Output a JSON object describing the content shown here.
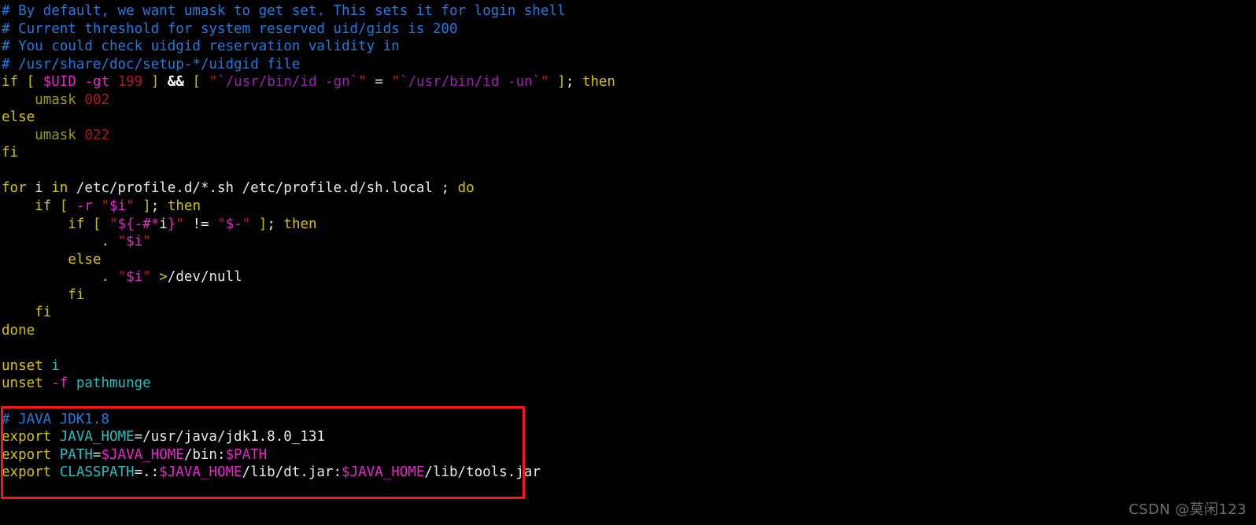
{
  "terminal": {
    "background_color": "#000000",
    "title": "/etc/profile shell configuration"
  },
  "colors": {
    "comment": "#1f7ae0",
    "keyword": "#d4c20a",
    "builtin": "#a0960a",
    "variable": "#e526c9",
    "identifier": "#25bdbd",
    "number": "#a81818",
    "string_quote": "#c01818",
    "command_substitution": "#9b1fb0",
    "plain_text": "#dadada",
    "annotation_red": "#fa1616",
    "watermark_gray": "#6e6e6e"
  },
  "code_lines": [
    {
      "id": "line-1",
      "text": "# By default, we want umask to get set. This sets it for login shell"
    },
    {
      "id": "line-2",
      "text": "# Current threshold for system reserved uid/gids is 200"
    },
    {
      "id": "line-3",
      "text": "# You could check uidgid reservation validity in"
    },
    {
      "id": "line-4",
      "text": "# /usr/share/doc/setup-*/uidgid file"
    },
    {
      "id": "line-5",
      "text": "if [ $UID -gt 199 ] && [ \"`/usr/bin/id -gn`\" = \"`/usr/bin/id -un`\" ]; then"
    },
    {
      "id": "line-6",
      "text": "   umask 002"
    },
    {
      "id": "line-7",
      "text": "else"
    },
    {
      "id": "line-8",
      "text": "   umask 022"
    },
    {
      "id": "line-9",
      "text": "fi"
    },
    {
      "id": "line-10",
      "text": ""
    },
    {
      "id": "line-11",
      "text": "for i in /etc/profile.d/*.sh /etc/profile.d/sh.local ; do"
    },
    {
      "id": "line-12",
      "text": "   if [ -r \"$i\" ]; then"
    },
    {
      "id": "line-13",
      "text": "       if [ \"${-#*i}\" != \"$-\" ]; then"
    },
    {
      "id": "line-14",
      "text": "           . \"$i\""
    },
    {
      "id": "line-15",
      "text": "       else"
    },
    {
      "id": "line-16",
      "text": "           . \"$i\" >/dev/null"
    },
    {
      "id": "line-17",
      "text": "       fi"
    },
    {
      "id": "line-18",
      "text": "   fi"
    },
    {
      "id": "line-19",
      "text": "done"
    },
    {
      "id": "line-20",
      "text": ""
    },
    {
      "id": "line-21",
      "text": "unset i"
    },
    {
      "id": "line-22",
      "text": "unset -f pathmunge"
    },
    {
      "id": "line-23",
      "text": ""
    },
    {
      "id": "line-24",
      "text": "# JAVA JDK1.8"
    },
    {
      "id": "line-25",
      "text": "export JAVA_HOME=/usr/java/jdk1.8.0_131"
    },
    {
      "id": "line-26",
      "text": "export PATH=$JAVA_HOME/bin:$PATH"
    },
    {
      "id": "line-27",
      "text": "export CLASSPATH=.:$JAVA_HOME/lib/dt.jar:$JAVA_HOME/lib/tools.jar"
    }
  ],
  "tokens": {
    "l1": {
      "comment": "# By default, we want umask to get set. This sets it for login shell"
    },
    "l2": {
      "comment": "# Current threshold for system reserved uid/gids is 200"
    },
    "l3": {
      "comment": "# You could check uidgid reservation validity in"
    },
    "l4": {
      "comment": "# /usr/share/doc/setup-*/uidgid file"
    },
    "l5": {
      "kw_if": "if",
      "br_open": "[",
      "var_uid": "$UID",
      "flag_gt": "-gt",
      "num_199": "199",
      "br_close": "]",
      "op_and": "&&",
      "br_open2": "[",
      "q1": "\"",
      "sub1": "`/usr/bin/id -gn`",
      "q2": "\"",
      "eq": "=",
      "q3": "\"",
      "sub2": "`/usr/bin/id -un`",
      "q4": "\"",
      "br_close2": "]",
      "semi": ";",
      "kw_then": "then"
    },
    "l6": {
      "builtin": "umask",
      "num": "002"
    },
    "l7": {
      "kw": "else"
    },
    "l8": {
      "builtin": "umask",
      "num": "022"
    },
    "l9": {
      "kw": "fi"
    },
    "l11": {
      "kw_for": "for",
      "var": "i",
      "kw_in": "in",
      "path1": "/etc/profile.d/*.sh",
      "path2": "/etc/profile.d/sh.local",
      "semi": ";",
      "kw_do": "do"
    },
    "l12": {
      "kw_if": "if",
      "br_open": "[",
      "flag_r": "-r",
      "q1": "\"",
      "var_i": "$i",
      "q2": "\"",
      "br_close": "]",
      "semi": ";",
      "kw_then": "then"
    },
    "l13": {
      "kw_if": "if",
      "br_open": "[",
      "q1": "\"",
      "param": "${-#*",
      "param_i": "i",
      "param_end": "}",
      "q2": "\"",
      "op_ne": "!=",
      "q3": "\"",
      "dollar_dash": "$-",
      "q4": "\"",
      "br_close": "]",
      "semi": ";",
      "kw_then": "then"
    },
    "l14": {
      "dot": ".",
      "q1": "\"",
      "var_i": "$i",
      "q2": "\""
    },
    "l15": {
      "kw": "else"
    },
    "l16": {
      "dot": ".",
      "q1": "\"",
      "var_i": "$i",
      "q2": "\"",
      "redir": ">",
      "path": "/dev/null"
    },
    "l17": {
      "kw": "fi"
    },
    "l18": {
      "kw": "fi"
    },
    "l19": {
      "kw": "done"
    },
    "l21": {
      "kw_unset": "unset",
      "ident": "i"
    },
    "l22": {
      "kw_unset": "unset",
      "flag_f": "-f",
      "ident": "pathmunge"
    },
    "l24": {
      "comment": "# JAVA JDK1.8"
    },
    "l25": {
      "kw_export": "export",
      "ident": "JAVA_HOME",
      "eq": "=",
      "value": "/usr/java/jdk1.8.0_131"
    },
    "l26": {
      "kw_export": "export",
      "ident": "PATH",
      "eq": "=",
      "var1": "$JAVA_HOME",
      "mid": "/bin:",
      "var2": "$PATH"
    },
    "l27": {
      "kw_export": "export",
      "ident": "CLASSPATH",
      "eq": "=.:",
      "var1": "$JAVA_HOME",
      "mid": "/lib/dt.jar:",
      "var2": "$JAVA_HOME",
      "tail": "/lib/tools.jar"
    }
  },
  "annotation": {
    "label": "java-env-highlight-box",
    "color": "#fa1616"
  },
  "watermark": {
    "text": "CSDN @莫闲123"
  }
}
